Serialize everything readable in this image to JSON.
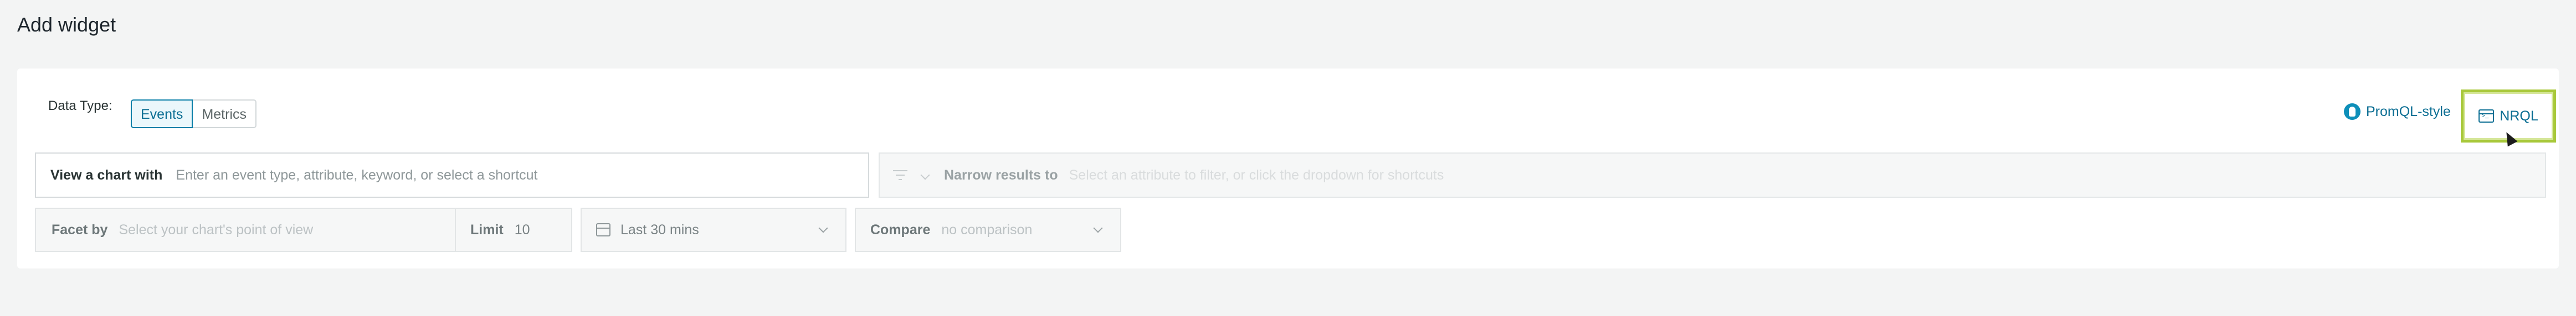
{
  "page": {
    "title": "Add widget"
  },
  "data_type": {
    "label": "Data Type:",
    "options": [
      {
        "label": "Events",
        "active": true
      },
      {
        "label": "Metrics",
        "active": false
      }
    ]
  },
  "modes": {
    "promql_label": "PromQL-style",
    "nrql_label": "NRQL"
  },
  "query": {
    "view_label": "View a chart with",
    "view_placeholder": "Enter an event type, attribute, keyword, or select a shortcut",
    "narrow_label": "Narrow results to",
    "narrow_placeholder": "Select an attribute to filter, or click the dropdown for shortcuts"
  },
  "options": {
    "facet_label": "Facet by",
    "facet_placeholder": "Select your chart's point of view",
    "limit_label": "Limit",
    "limit_value": "10",
    "time_range": "Last 30 mins",
    "compare_label": "Compare",
    "compare_placeholder": "no comparison"
  },
  "colors": {
    "accent": "#0b6e93",
    "highlight": "#a8c83a",
    "background": "#f3f4f4"
  }
}
